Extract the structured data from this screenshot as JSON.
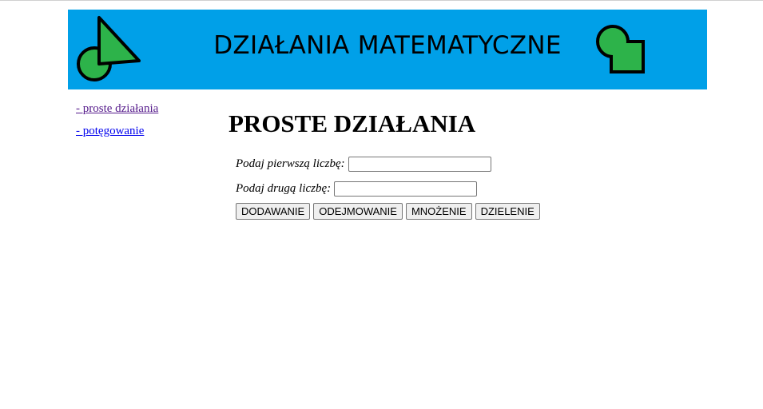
{
  "header": {
    "title": "DZIAŁANIA MATEMATYCZNE",
    "background": "#00a0e8",
    "logo_left": "green-circle-triangle-icon",
    "logo_right": "green-circle-square-icon",
    "shape_color": "#2db34a"
  },
  "sidebar": {
    "items": [
      {
        "label": "- proste działania"
      },
      {
        "label": "- potęgowanie"
      }
    ]
  },
  "main": {
    "title": "PROSTE DZIAŁANIA",
    "fields": [
      {
        "label": "Podaj pierwszą liczbę:",
        "value": ""
      },
      {
        "label": "Podaj drugą liczbę:",
        "value": ""
      }
    ],
    "buttons": [
      {
        "label": "DODAWANIE"
      },
      {
        "label": "ODEJMOWANIE"
      },
      {
        "label": "MNOŻENIE"
      },
      {
        "label": "DZIELENIE"
      }
    ]
  }
}
